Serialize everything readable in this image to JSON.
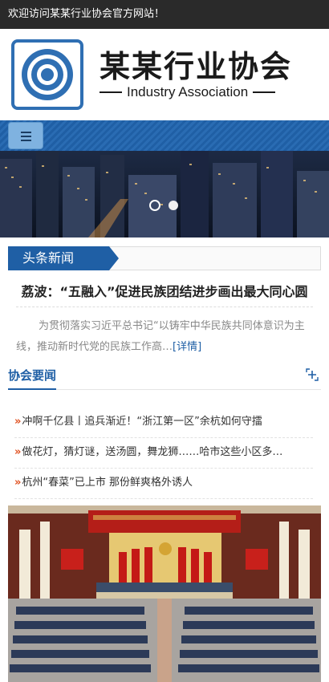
{
  "topbar": {
    "welcome": "欢迎访问某某行业协会官方网站！"
  },
  "logo": {
    "name_cn": "某某行业协会",
    "name_en": "Industry Association",
    "icon": "target-icon"
  },
  "nav": {
    "menu_icon": "hamburger-menu-icon"
  },
  "banner": {
    "slide_count": 2,
    "active_slide": 1
  },
  "headline_section": {
    "tag": "头条新闻",
    "title": "荔波：“五融入”促进民族团结进步画出最大同心圆",
    "summary": "为贯彻落实习近平总书记“以铸牢中华民族共同体意识为主线，推动新时代党的民族工作高…",
    "more": "[详情]"
  },
  "association_news": {
    "title": "协会要闻",
    "more_icon": "plus-icon",
    "items": [
      "冲啊千亿县丨追兵渐近！“浙江第一区”余杭如何守擂",
      "做花灯，猜灯谜，送汤圆，舞龙狮……哈市这些小区多…",
      "杭州“春菜”已上市 那份鲜爽格外诱人"
    ]
  },
  "colors": {
    "brand_blue": "#1f5fa5",
    "bullet_orange": "#e0501f",
    "topbar": "#2a2a2a"
  }
}
